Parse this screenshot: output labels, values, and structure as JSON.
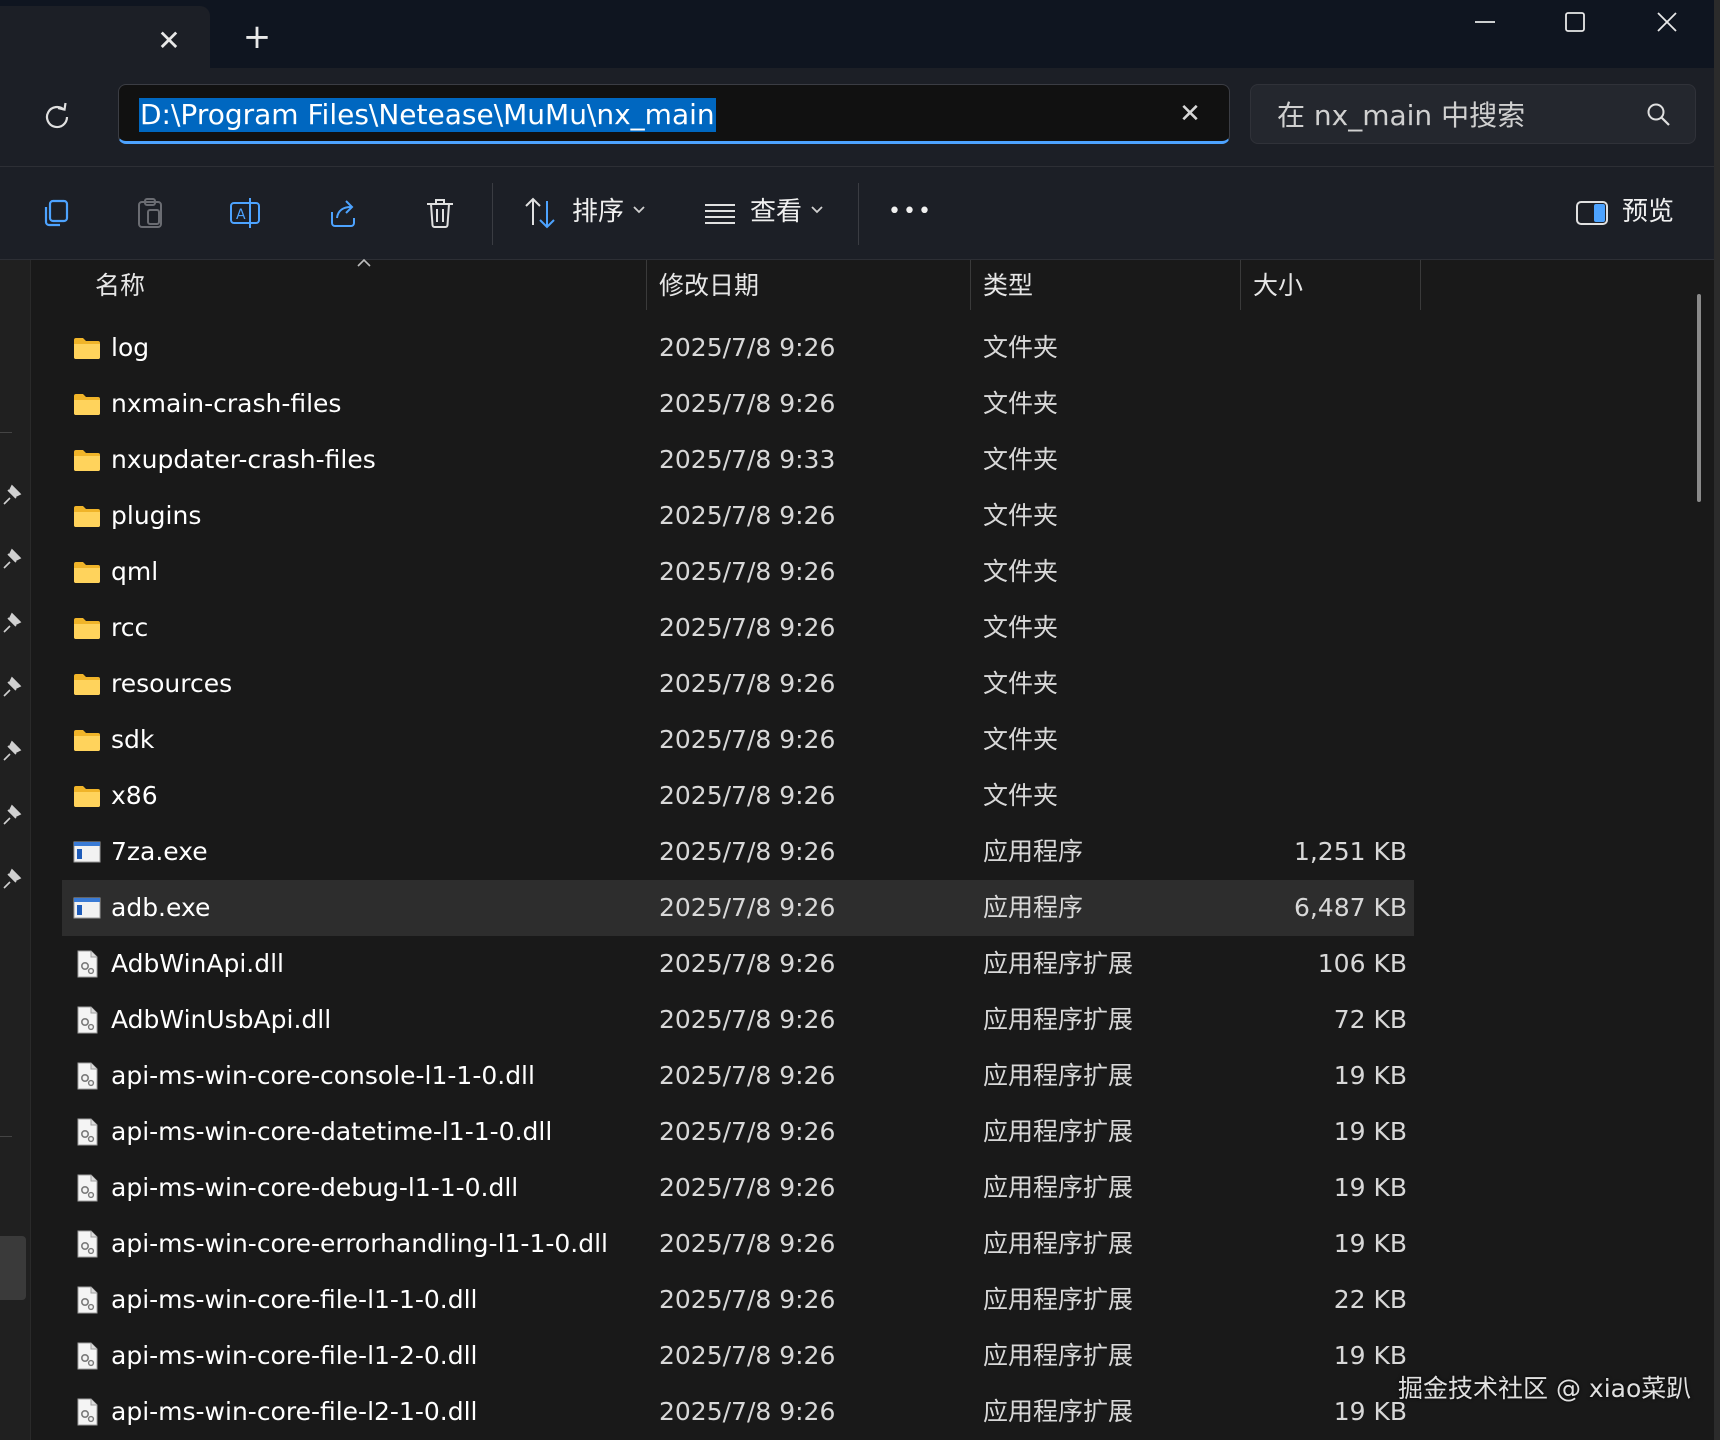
{
  "window": {
    "tab_close": "✕",
    "new_tab": "+",
    "minimize": "minimize",
    "maximize": "maximize",
    "close": "close"
  },
  "address": {
    "path": "D:\\Program Files\\Netease\\MuMu\\nx_main",
    "clear": "✕"
  },
  "search": {
    "placeholder": "在 nx_main 中搜索"
  },
  "toolbar": {
    "sort_label": "排序",
    "view_label": "查看",
    "more_label": "•••",
    "preview_label": "预览",
    "icons": [
      "copy-icon",
      "paste-icon",
      "rename-icon",
      "share-icon",
      "delete-icon",
      "sort-icon",
      "view-list-icon",
      "more-icon",
      "preview-pane-icon"
    ]
  },
  "columns": {
    "name": "名称",
    "modified": "修改日期",
    "type": "类型",
    "size": "大小"
  },
  "files": [
    {
      "name": "log",
      "date": "2025/7/8 9:26",
      "type": "文件夹",
      "size": "",
      "icon": "folder"
    },
    {
      "name": "nxmain-crash-files",
      "date": "2025/7/8 9:26",
      "type": "文件夹",
      "size": "",
      "icon": "folder"
    },
    {
      "name": "nxupdater-crash-files",
      "date": "2025/7/8 9:33",
      "type": "文件夹",
      "size": "",
      "icon": "folder"
    },
    {
      "name": "plugins",
      "date": "2025/7/8 9:26",
      "type": "文件夹",
      "size": "",
      "icon": "folder"
    },
    {
      "name": "qml",
      "date": "2025/7/8 9:26",
      "type": "文件夹",
      "size": "",
      "icon": "folder"
    },
    {
      "name": "rcc",
      "date": "2025/7/8 9:26",
      "type": "文件夹",
      "size": "",
      "icon": "folder"
    },
    {
      "name": "resources",
      "date": "2025/7/8 9:26",
      "type": "文件夹",
      "size": "",
      "icon": "folder"
    },
    {
      "name": "sdk",
      "date": "2025/7/8 9:26",
      "type": "文件夹",
      "size": "",
      "icon": "folder"
    },
    {
      "name": "x86",
      "date": "2025/7/8 9:26",
      "type": "文件夹",
      "size": "",
      "icon": "folder"
    },
    {
      "name": "7za.exe",
      "date": "2025/7/8 9:26",
      "type": "应用程序",
      "size": "1,251 KB",
      "icon": "exe"
    },
    {
      "name": "adb.exe",
      "date": "2025/7/8 9:26",
      "type": "应用程序",
      "size": "6,487 KB",
      "icon": "exe",
      "selected": true
    },
    {
      "name": "AdbWinApi.dll",
      "date": "2025/7/8 9:26",
      "type": "应用程序扩展",
      "size": "106 KB",
      "icon": "dll"
    },
    {
      "name": "AdbWinUsbApi.dll",
      "date": "2025/7/8 9:26",
      "type": "应用程序扩展",
      "size": "72 KB",
      "icon": "dll"
    },
    {
      "name": "api-ms-win-core-console-l1-1-0.dll",
      "date": "2025/7/8 9:26",
      "type": "应用程序扩展",
      "size": "19 KB",
      "icon": "dll"
    },
    {
      "name": "api-ms-win-core-datetime-l1-1-0.dll",
      "date": "2025/7/8 9:26",
      "type": "应用程序扩展",
      "size": "19 KB",
      "icon": "dll"
    },
    {
      "name": "api-ms-win-core-debug-l1-1-0.dll",
      "date": "2025/7/8 9:26",
      "type": "应用程序扩展",
      "size": "19 KB",
      "icon": "dll"
    },
    {
      "name": "api-ms-win-core-errorhandling-l1-1-0.dll",
      "date": "2025/7/8 9:26",
      "type": "应用程序扩展",
      "size": "19 KB",
      "icon": "dll"
    },
    {
      "name": "api-ms-win-core-file-l1-1-0.dll",
      "date": "2025/7/8 9:26",
      "type": "应用程序扩展",
      "size": "22 KB",
      "icon": "dll"
    },
    {
      "name": "api-ms-win-core-file-l1-2-0.dll",
      "date": "2025/7/8 9:26",
      "type": "应用程序扩展",
      "size": "19 KB",
      "icon": "dll"
    },
    {
      "name": "api-ms-win-core-file-l2-1-0.dll",
      "date": "2025/7/8 9:26",
      "type": "应用程序扩展",
      "size": "19 KB",
      "icon": "dll"
    }
  ],
  "watermark": "掘金技术社区 @ xiao菜趴",
  "colors": {
    "accent": "#4da3ff",
    "selection": "#0067c0",
    "folder": "#f4c53d",
    "background": "#191919"
  }
}
